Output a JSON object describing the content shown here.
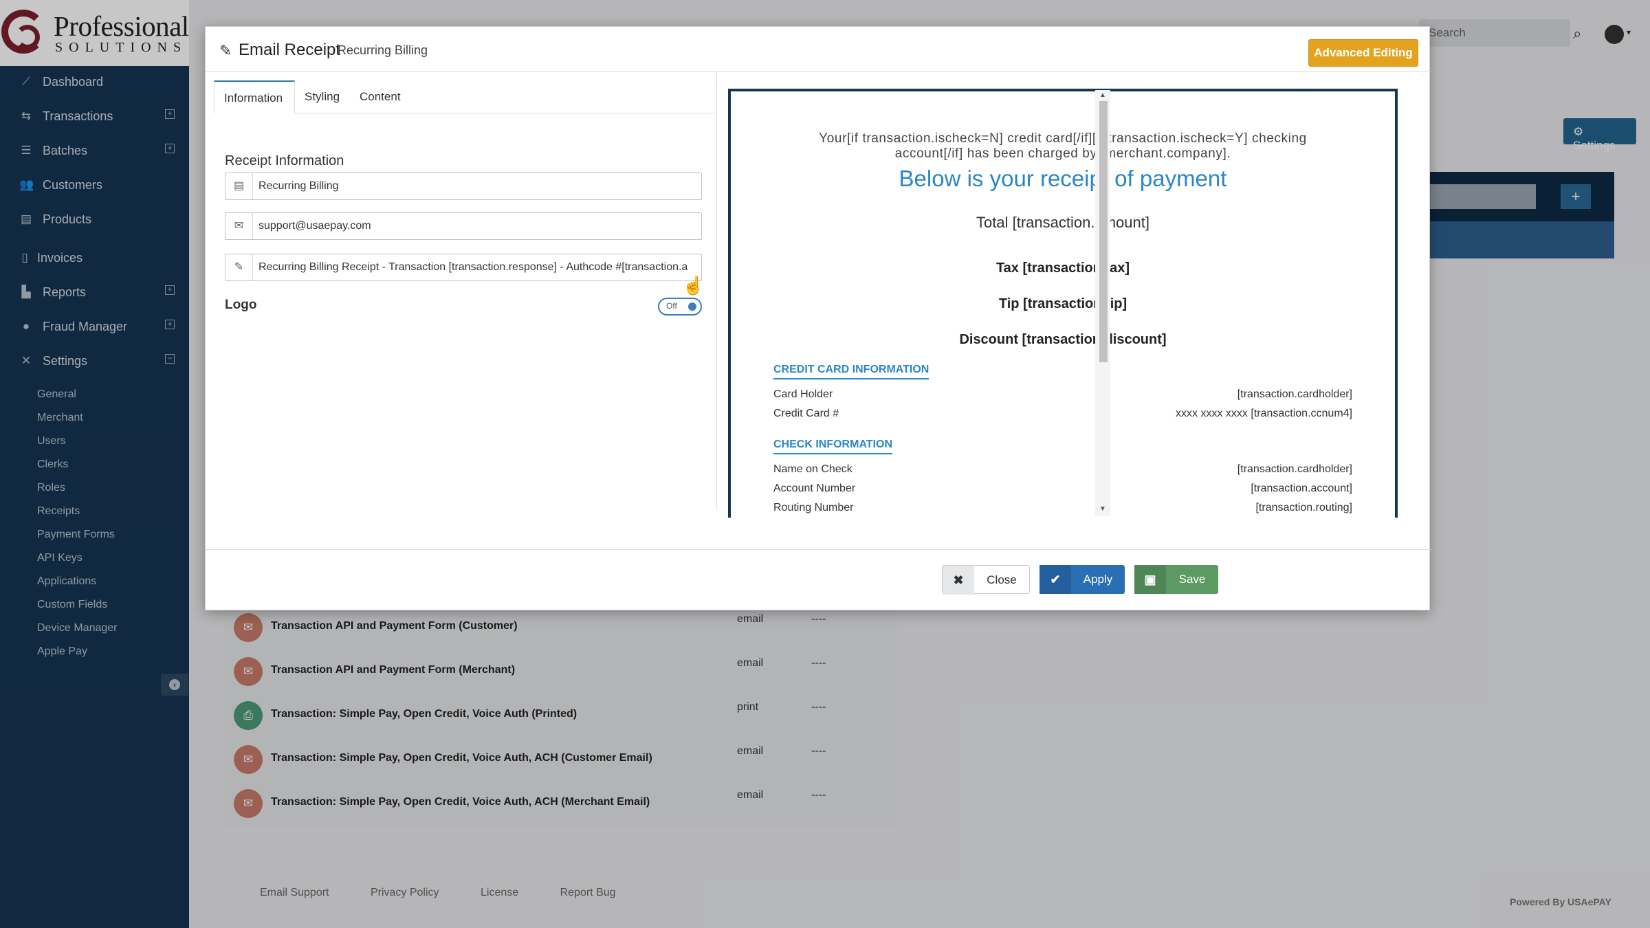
{
  "brand": {
    "name": "Professional",
    "tagline": "SOLUTIONS"
  },
  "sidebar": {
    "items": [
      {
        "label": "Dashboard",
        "icon": "dashboard-icon",
        "expand": ""
      },
      {
        "label": "Transactions",
        "icon": "transactions-icon",
        "expand": "+"
      },
      {
        "label": "Batches",
        "icon": "batches-icon",
        "expand": "+"
      },
      {
        "label": "Customers",
        "icon": "customers-icon",
        "expand": ""
      },
      {
        "label": "Products",
        "icon": "products-icon",
        "expand": ""
      },
      {
        "label": "Invoices",
        "icon": "invoices-icon",
        "expand": ""
      },
      {
        "label": "Reports",
        "icon": "reports-icon",
        "expand": "+"
      },
      {
        "label": "Fraud Manager",
        "icon": "fraud-icon",
        "expand": "+"
      },
      {
        "label": "Settings",
        "icon": "settings-icon",
        "expand": "−"
      }
    ],
    "settings_sub": [
      "General",
      "Merchant",
      "Users",
      "Clerks",
      "Roles",
      "Receipts",
      "Payment Forms",
      "API Keys",
      "Applications",
      "Custom Fields",
      "Device Manager",
      "Apple Pay"
    ]
  },
  "header": {
    "search_placeholder": "Search",
    "settings_label": "Settings"
  },
  "background_list": [
    {
      "name": "Transaction API and Payment Form (Customer)",
      "type": "email",
      "status": "----",
      "icon": "envelope-icon"
    },
    {
      "name": "Transaction API and Payment Form (Merchant)",
      "type": "email",
      "status": "----",
      "icon": "envelope-icon"
    },
    {
      "name": "Transaction: Simple Pay, Open Credit, Voice Auth (Printed)",
      "type": "print",
      "status": "----",
      "icon": "printer-icon"
    },
    {
      "name": "Transaction: Simple Pay, Open Credit, Voice Auth, ACH (Customer Email)",
      "type": "email",
      "status": "----",
      "icon": "envelope-icon"
    },
    {
      "name": "Transaction: Simple Pay, Open Credit, Voice Auth, ACH (Merchant Email)",
      "type": "email",
      "status": "----",
      "icon": "envelope-icon"
    }
  ],
  "footer": {
    "links": [
      "Email Support",
      "Privacy Policy",
      "License",
      "Report Bug"
    ],
    "powered": "Powered By USAePAY"
  },
  "modal": {
    "title": "Email Receipt",
    "subtitle": "Recurring Billing",
    "advanced_button": "Advanced Editing",
    "tabs": [
      "Information",
      "Styling",
      "Content"
    ],
    "active_tab": "Information",
    "section_label": "Receipt Information",
    "fields": {
      "name": "Recurring Billing",
      "from_email": "support@usaepay.com",
      "subject": "Recurring Billing Receipt - Transaction [transaction.response] - Authcode #[transaction.a"
    },
    "logo_label": "Logo",
    "logo_toggle": "Off",
    "buttons": {
      "close": "Close",
      "apply": "Apply",
      "save": "Save"
    }
  },
  "preview": {
    "intro_line1": "Your[if transaction.ischeck=N] credit card[/if][if transaction.ischeck=Y] checking",
    "intro_line2": "account[/if] has been charged by [merchant.company].",
    "heading": "Below is your receipt of payment",
    "total": "Total [transaction.amount]",
    "tax": "Tax [transaction.tax]",
    "tip": "Tip [transaction.tip]",
    "discount": "Discount [transaction.discount]",
    "cc_section": "CREDIT CARD INFORMATION",
    "cc_rows": [
      {
        "k": "Card Holder",
        "v": "[transaction.cardholder]"
      },
      {
        "k": "Credit Card #",
        "v": "xxxx xxxx xxxx [transaction.ccnum4]"
      }
    ],
    "check_section": "CHECK INFORMATION",
    "check_rows": [
      {
        "k": "Name on Check",
        "v": "[transaction.cardholder]"
      },
      {
        "k": "Account Number",
        "v": "[transaction.account]"
      },
      {
        "k": "Routing Number",
        "v": "[transaction.routing]"
      }
    ]
  }
}
